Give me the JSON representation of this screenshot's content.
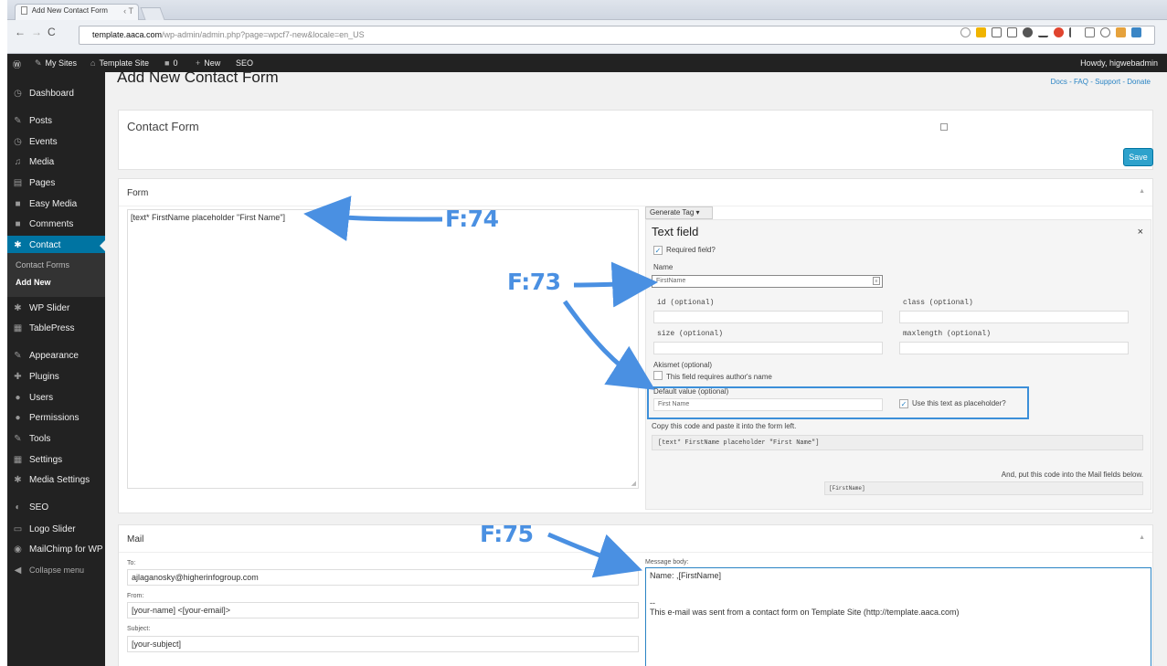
{
  "browser": {
    "tab_title": "Add New Contact Form",
    "tab_extra": "‹ T",
    "url_host": "template.aaca.com",
    "url_path": "/wp-admin/admin.php?page=wpcf7-new&locale=en_US"
  },
  "admin_bar": {
    "my_sites": "My Sites",
    "site_name": "Template Site",
    "comments_count": "0",
    "new": "New",
    "seo": "SEO",
    "howdy": "Howdy, higwebadmin"
  },
  "sidebar": {
    "items": [
      {
        "label": "Dashboard",
        "icon": "dashboard-icon"
      },
      {
        "label": "Posts",
        "icon": "pin-icon"
      },
      {
        "label": "Events",
        "icon": "events-icon"
      },
      {
        "label": "Media",
        "icon": "media-icon"
      },
      {
        "label": "Pages",
        "icon": "page-icon"
      },
      {
        "label": "Easy Media",
        "icon": "easy-media-icon"
      },
      {
        "label": "Comments",
        "icon": "comment-icon"
      },
      {
        "label": "Contact",
        "icon": "gear-icon"
      },
      {
        "label": "WP Slider",
        "icon": "gear-icon"
      },
      {
        "label": "TablePress",
        "icon": "table-icon"
      },
      {
        "label": "Appearance",
        "icon": "brush-icon"
      },
      {
        "label": "Plugins",
        "icon": "plugin-icon"
      },
      {
        "label": "Users",
        "icon": "user-icon"
      },
      {
        "label": "Permissions",
        "icon": "users-icon"
      },
      {
        "label": "Tools",
        "icon": "wrench-icon"
      },
      {
        "label": "Settings",
        "icon": "settings-icon"
      },
      {
        "label": "Media Settings",
        "icon": "gear-icon"
      },
      {
        "label": "SEO",
        "icon": "seo-icon"
      },
      {
        "label": "Logo Slider",
        "icon": "slider-icon"
      },
      {
        "label": "MailChimp for WP",
        "icon": "mailchimp-icon"
      },
      {
        "label": "Collapse menu",
        "icon": "collapse-icon"
      }
    ],
    "submenu": {
      "contact_forms": "Contact Forms",
      "add_new": "Add New"
    }
  },
  "page": {
    "title": "Add New Contact Form",
    "help_links": "Docs - FAQ - Support - Donate",
    "form_title_value": "Contact Form",
    "save_label": "Save"
  },
  "form": {
    "heading": "Form",
    "toggle": "▲",
    "textarea_value": "[text* FirstName placeholder \"First Name\"]",
    "generate_tag": "Generate Tag ▾",
    "tag_pane": {
      "title": "Text field",
      "close": "×",
      "required_label": "Required field?",
      "name_label": "Name",
      "name_value": "FirstName",
      "id_label": "id (optional)",
      "class_label": "class (optional)",
      "size_label": "size (optional)",
      "maxlength_label": "maxlength (optional)",
      "akismet_label": "Akismet (optional)",
      "akismet_check": "This field requires author's name",
      "default_label": "Default value (optional)",
      "default_value": "First Name",
      "placeholder_check": "Use this text as placeholder?",
      "copy_note": "Copy this code and paste it into the form left.",
      "code": "[text* FirstName placeholder \"First Name\"]",
      "mail_note": "And, put this code into the Mail fields below.",
      "mail_tag": "[FirstName]"
    }
  },
  "mail": {
    "heading": "Mail",
    "toggle": "▲",
    "to_label": "To:",
    "to_value": "ajlaganosky@higherinfogroup.com",
    "from_label": "From:",
    "from_value": "[your-name] <[your-email]>",
    "subject_label": "Subject:",
    "subject_value": "[your-subject]",
    "body_label": "Message body:",
    "body_lines": [
      "Name: ,[FirstName]",
      "",
      "--",
      "This e-mail was sent from a contact form on Template Site (http://template.aaca.com)"
    ]
  },
  "annotations": {
    "f74": "F:74",
    "f73": "F:73",
    "f75": "F:75"
  },
  "colors": {
    "admin_dark": "#222222",
    "active_blue": "#0074a2",
    "annotation_blue": "#4a90e2",
    "save_blue": "#2ea2cc"
  }
}
